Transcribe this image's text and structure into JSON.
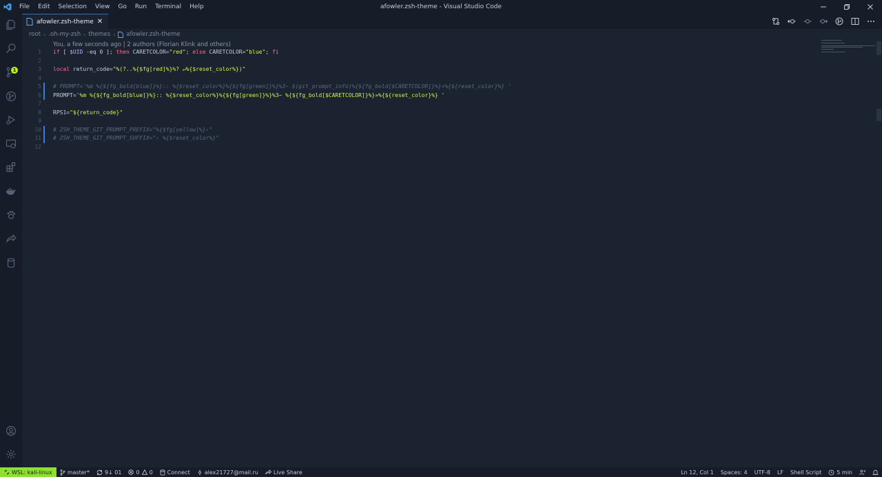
{
  "window": {
    "title": "afowler.zsh-theme - Visual Studio Code",
    "menu": [
      "File",
      "Edit",
      "Selection",
      "View",
      "Go",
      "Run",
      "Terminal",
      "Help"
    ]
  },
  "activity_bar": {
    "icons": [
      "explorer-icon",
      "search-icon",
      "source-control-icon",
      "git-graph-icon",
      "run-debug-icon",
      "remote-explorer-icon",
      "extensions-icon",
      "docker-icon",
      "paw-icon",
      "live-share-icon",
      "database-icon"
    ],
    "source_control_badge": "1",
    "bottom_icons": [
      "account-icon",
      "settings-gear-icon"
    ]
  },
  "tab": {
    "label": "afowler.zsh-theme",
    "close": "✕"
  },
  "breadcrumb": [
    "root",
    ".oh-my-zsh",
    "themes",
    "afowler.zsh-theme"
  ],
  "editor": {
    "blame": "You, a few seconds ago | 2 authors (Florian Klink and others)",
    "line_numbers": [
      "1",
      "2",
      "3",
      "4",
      "5",
      "6",
      "7",
      "8",
      "9",
      "10",
      "11",
      "12"
    ],
    "lines": [
      [
        {
          "t": "if",
          "c": "kw"
        },
        {
          "t": " [ ",
          "c": "plain"
        },
        {
          "t": "$UID",
          "c": "var"
        },
        {
          "t": " -eq 0 ]; ",
          "c": "plain"
        },
        {
          "t": "then",
          "c": "kw"
        },
        {
          "t": " CARETCOLOR=",
          "c": "plain"
        },
        {
          "t": "\"red\"",
          "c": "str"
        },
        {
          "t": "; ",
          "c": "plain"
        },
        {
          "t": "else",
          "c": "kw"
        },
        {
          "t": " CARETCOLOR=",
          "c": "plain"
        },
        {
          "t": "\"blue\"",
          "c": "str"
        },
        {
          "t": "; ",
          "c": "plain"
        },
        {
          "t": "fi",
          "c": "kw"
        }
      ],
      [],
      [
        {
          "t": "local",
          "c": "kw"
        },
        {
          "t": " return_code=",
          "c": "plain"
        },
        {
          "t": "\"%(?..%{$fg[red]%}%? ↵%{$reset_color%})\"",
          "c": "str"
        }
      ],
      [],
      [
        {
          "t": "# PROMPT='%m %{${fg_bold[blue]}%}:: %{$reset_color%}%{${fg[green]}%}%3~ $(git_prompt_info)%{${fg_bold[$CARETCOLOR]}%}»%{${reset_color}%} '",
          "c": "comment"
        }
      ],
      [
        {
          "t": "PROMPT=",
          "c": "plain"
        },
        {
          "t": "'%m %{${fg_bold[blue]}%}:: %{$reset_color%}%{${fg[green]}%}%3~ %{${fg_bold[$CARETCOLOR]}%}»%{${reset_color}%} '",
          "c": "str"
        }
      ],
      [],
      [
        {
          "t": "RPS1=",
          "c": "plain"
        },
        {
          "t": "\"${return_code}\"",
          "c": "str"
        }
      ],
      [],
      [
        {
          "t": "# ZSH_THEME_GIT_PROMPT_PREFIX=\"%{$fg[yellow]%}‹\"",
          "c": "comment"
        }
      ],
      [
        {
          "t": "# ZSH_THEME_GIT_PROMPT_SUFFIX=\"› %{$reset_color%}\"",
          "c": "comment"
        }
      ],
      []
    ]
  },
  "status_bar": {
    "remote": "WSL: kali-linux",
    "branch": "master*",
    "sync": "9↓ 01",
    "problems_errors": "0",
    "problems_warnings": "0",
    "connect": "Connect",
    "account": "alex21727@mail.ru",
    "live_share": "Live Share",
    "position": "Ln 12, Col 1",
    "spaces": "Spaces: 4",
    "encoding": "UTF-8",
    "eol": "LF",
    "language": "Shell Script",
    "time": "5 min"
  },
  "colors": {
    "accent": "#b8f01a",
    "remote_bg": "#8ee02e",
    "editor_bg": "#1b2331",
    "chrome_bg": "#161c28"
  }
}
